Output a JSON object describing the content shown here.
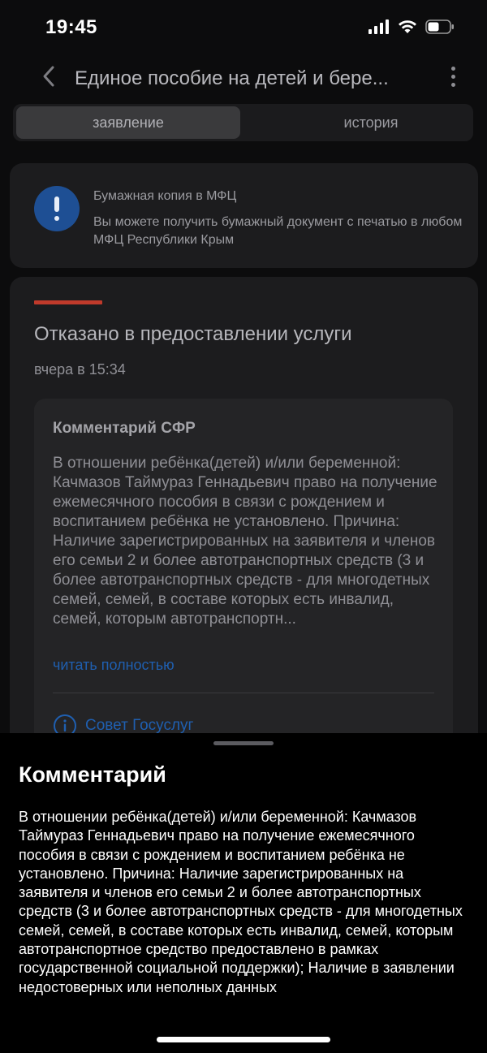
{
  "status_bar": {
    "time": "19:45"
  },
  "header": {
    "title": "Единое пособие на детей и бере..."
  },
  "tabs": [
    {
      "label": "заявление",
      "active": true
    },
    {
      "label": "история",
      "active": false
    }
  ],
  "info": {
    "title": "Бумажная копия в МФЦ",
    "text": "Вы можете получить бумажный документ с печатью в любом МФЦ Республики Крым"
  },
  "application_status": {
    "heading": "Отказано в предоставлении услуги",
    "time": "вчера в 15:34",
    "accent_color": "#c03a2b"
  },
  "comment": {
    "title": "Комментарий СФР",
    "text": "В отношении ребёнка(детей) и/или беременной: Качмазов Таймураз Геннадьевич право на получение ежемесячного пособия в связи с рождением и воспитанием ребёнка не установлено. Причина: Наличие зарегистрированных на заявителя и членов его семьи 2 и более автотранспортных средств (3 и более автотранспортных средств - для многодетных семей, семей, в составе которых есть инвалид, семей, которым автотранспортн...",
    "read_more": "читать полностью",
    "tip_label": "Совет Госуслуг"
  },
  "sheet": {
    "title": "Комментарий",
    "text": "В отношении ребёнка(детей) и/или беременной: Качмазов Таймураз Геннадьевич право на получение ежемесячного пособия в связи с рождением и воспитанием ребёнка не установлено. Причина: Наличие зарегистрированных на заявителя и членов его семьи 2 и более автотранспортных средств (3 и более автотранспортных средств - для многодетных семей, семей, в составе которых есть инвалид, семей, которым автотранспортное средство предоставлено в рамках государственной социальной поддержки); Наличие в заявлении недостоверных или неполных данных"
  },
  "icons": {
    "back": "chevron-left-icon",
    "menu": "more-vertical-icon",
    "info": "exclamation-icon",
    "tip": "info-circle-icon",
    "signal": "cellular-signal-icon",
    "wifi": "wifi-icon",
    "battery": "battery-icon"
  }
}
